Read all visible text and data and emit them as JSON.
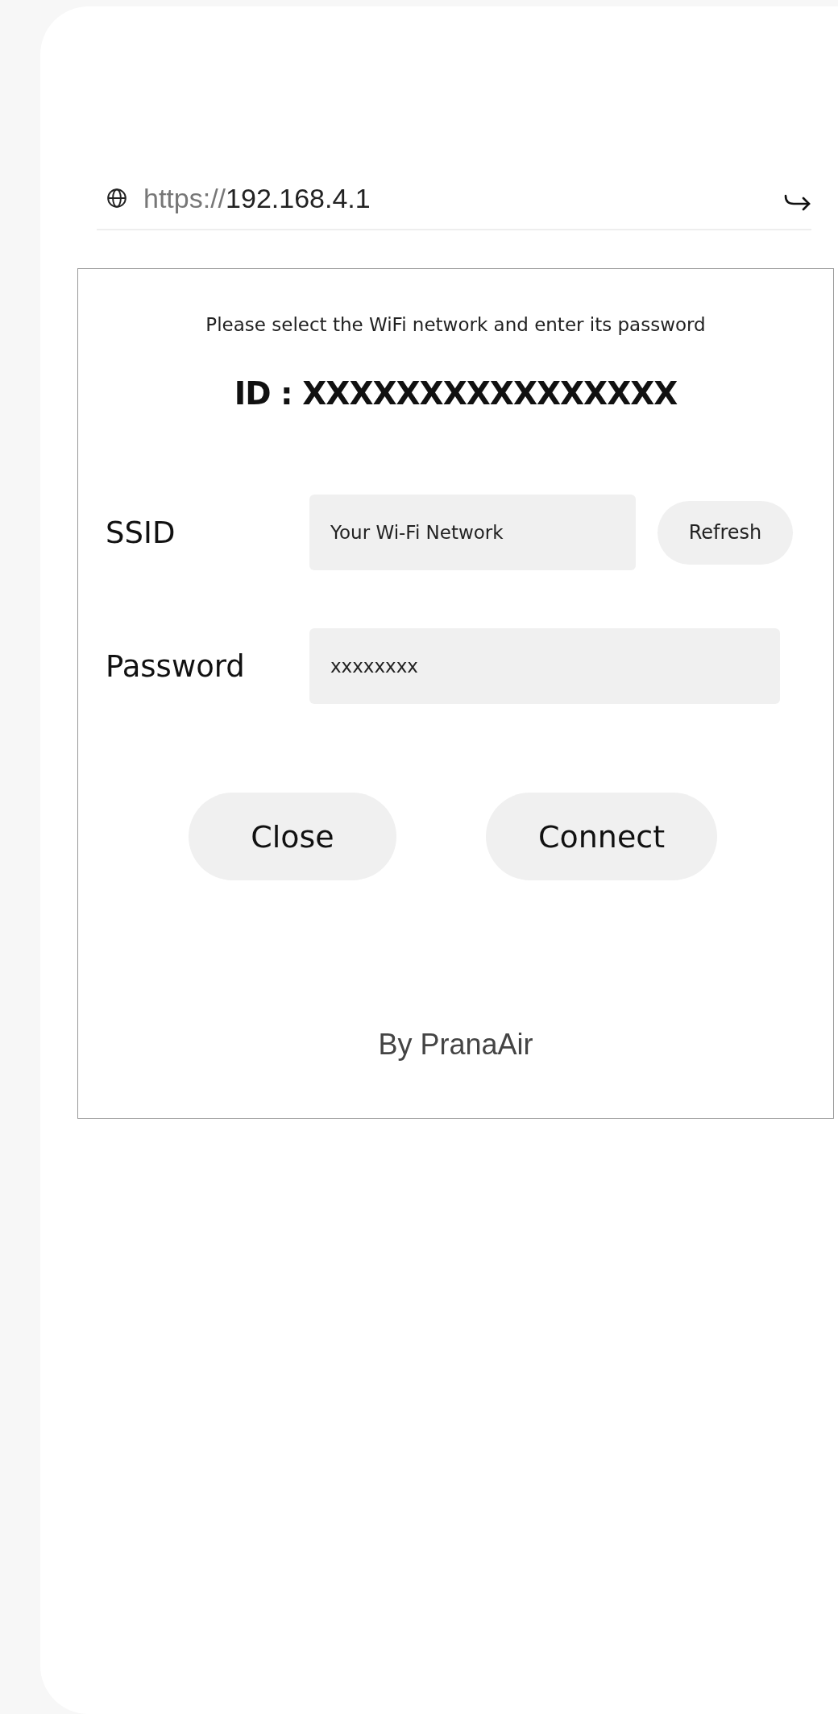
{
  "address_bar": {
    "scheme": "https://",
    "host": "192.168.4.1"
  },
  "form": {
    "instruction": "Please select the WiFi network and enter its password",
    "device_id": "ID : XXXXXXXXXXXXXXXX",
    "fields": [
      {
        "label": "SSID",
        "value": "Your Wi-Fi Network",
        "button": "Refresh"
      },
      {
        "label": "Password",
        "value": "xxxxxxxx"
      }
    ],
    "buttons": [
      "Close",
      "Connect"
    ],
    "footer": "By PranaAir"
  }
}
